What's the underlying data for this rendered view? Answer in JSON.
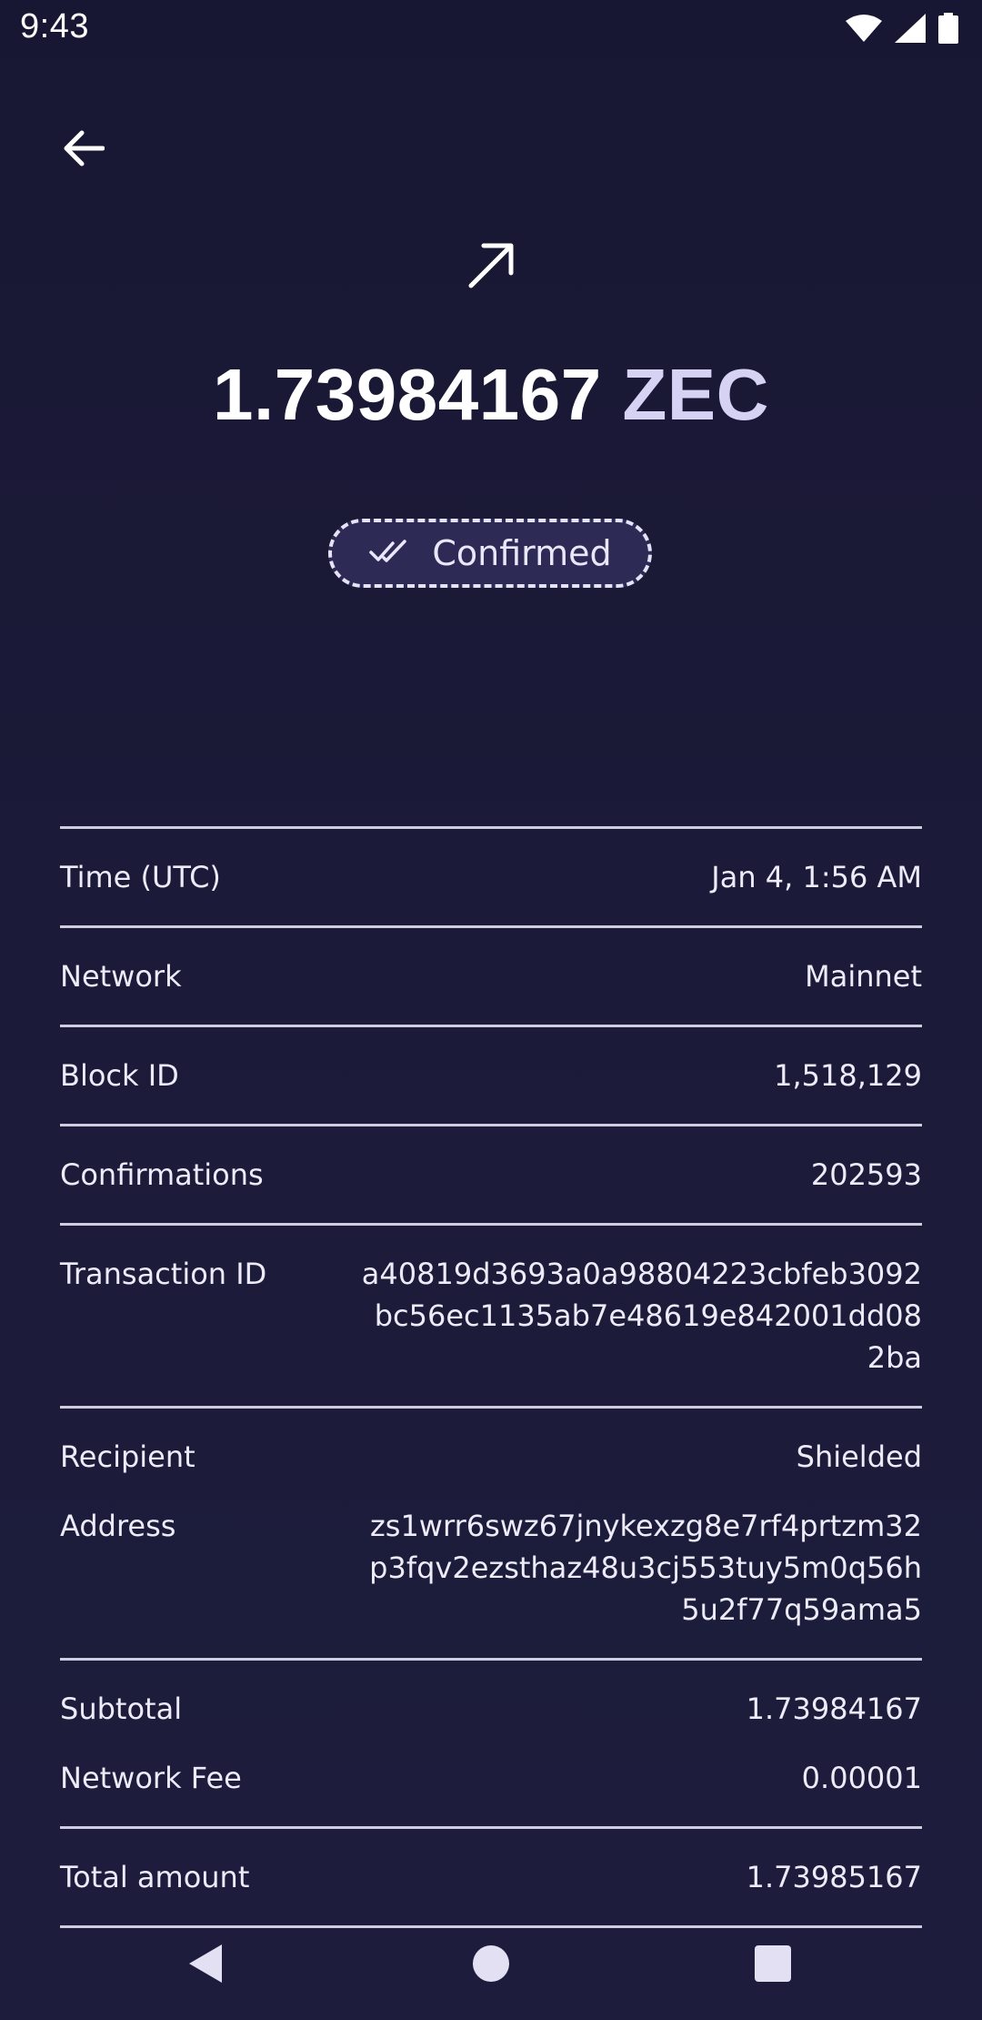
{
  "status_bar": {
    "time": "9:43"
  },
  "header": {
    "back_icon": "arrow-left-icon",
    "direction_icon": "arrow-up-right-icon"
  },
  "transaction": {
    "amount_value": "1.73984167",
    "amount_currency": "ZEC",
    "status_label": "Confirmed",
    "status_icon": "double-check-icon"
  },
  "details": {
    "time_label": "Time (UTC)",
    "time_value": "Jan 4, 1:56 AM",
    "network_label": "Network",
    "network_value": "Mainnet",
    "block_label": "Block ID",
    "block_value": "1,518,129",
    "confirmations_label": "Confirmations",
    "confirmations_value": "202593",
    "txid_label": "Transaction ID",
    "txid_value": "a40819d3693a0a98804223cbfeb3092bc56ec1135ab7e48619e842001dd082ba",
    "recipient_label": "Recipient",
    "recipient_value": "Shielded",
    "address_label": "Address",
    "address_value": "zs1wrr6swz67jnykexzg8e7rf4prtzm32p3fqv2ezsthaz48u3cj553tuy5m0q56h5u2f77q59ama5",
    "subtotal_label": "Subtotal",
    "subtotal_value": "1.73984167",
    "fee_label": "Network Fee",
    "fee_value": "0.00001",
    "total_label": "Total amount",
    "total_value": "1.73985167"
  },
  "colors": {
    "background": "#1b1a37",
    "pill_background": "#2d2b55",
    "currency_text": "#d6d2f4"
  }
}
